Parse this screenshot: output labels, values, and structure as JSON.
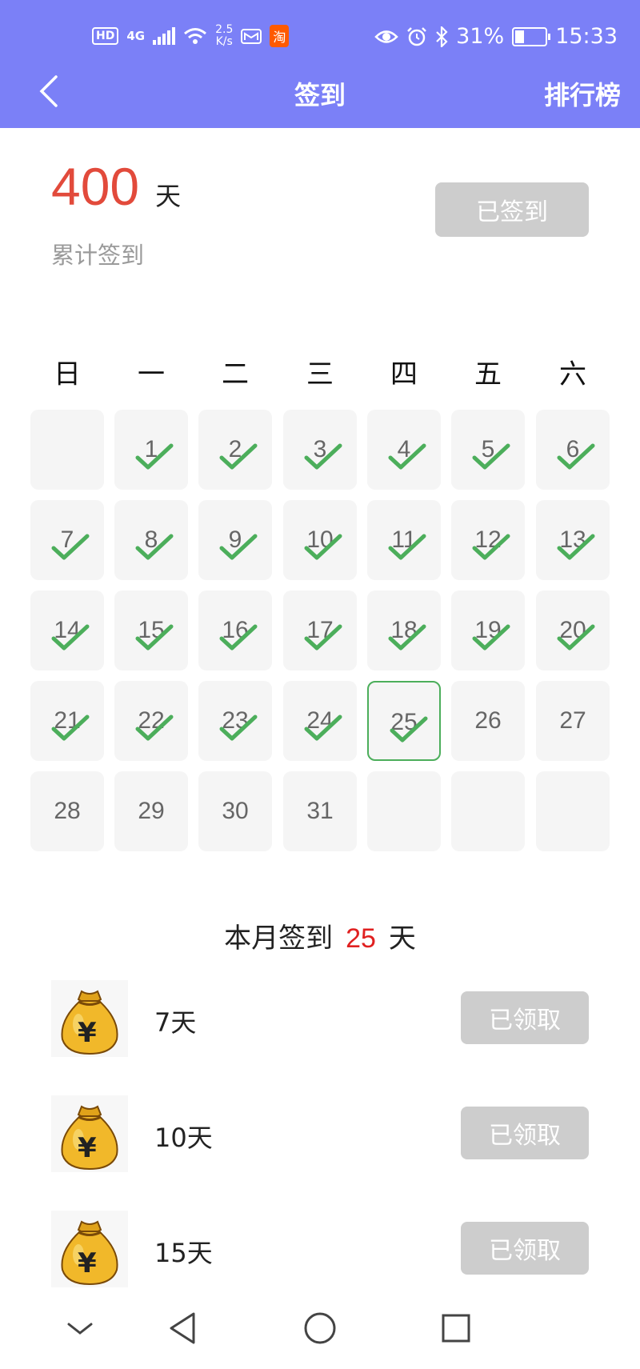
{
  "status_bar": {
    "hd": "HD",
    "network": "4G",
    "speed_value": "2.5",
    "speed_unit": "K/s",
    "taobao": "淘",
    "battery": "31%",
    "battery_level": 0.31,
    "time": "15:33"
  },
  "header": {
    "title": "签到",
    "right_action": "排行榜",
    "background_color": "#7b80f7"
  },
  "summary": {
    "total_days": "400",
    "unit": "天",
    "label": "累计签到",
    "signed_button": "已签到"
  },
  "calendar": {
    "weekdays": [
      "日",
      "一",
      "二",
      "三",
      "四",
      "五",
      "六"
    ],
    "days": [
      {
        "num": "",
        "checked": false,
        "today": false
      },
      {
        "num": "1",
        "checked": true,
        "today": false
      },
      {
        "num": "2",
        "checked": true,
        "today": false
      },
      {
        "num": "3",
        "checked": true,
        "today": false
      },
      {
        "num": "4",
        "checked": true,
        "today": false
      },
      {
        "num": "5",
        "checked": true,
        "today": false
      },
      {
        "num": "6",
        "checked": true,
        "today": false
      },
      {
        "num": "7",
        "checked": true,
        "today": false
      },
      {
        "num": "8",
        "checked": true,
        "today": false
      },
      {
        "num": "9",
        "checked": true,
        "today": false
      },
      {
        "num": "10",
        "checked": true,
        "today": false
      },
      {
        "num": "11",
        "checked": true,
        "today": false
      },
      {
        "num": "12",
        "checked": true,
        "today": false
      },
      {
        "num": "13",
        "checked": true,
        "today": false
      },
      {
        "num": "14",
        "checked": true,
        "today": false
      },
      {
        "num": "15",
        "checked": true,
        "today": false
      },
      {
        "num": "16",
        "checked": true,
        "today": false
      },
      {
        "num": "17",
        "checked": true,
        "today": false
      },
      {
        "num": "18",
        "checked": true,
        "today": false
      },
      {
        "num": "19",
        "checked": true,
        "today": false
      },
      {
        "num": "20",
        "checked": true,
        "today": false
      },
      {
        "num": "21",
        "checked": true,
        "today": false
      },
      {
        "num": "22",
        "checked": true,
        "today": false
      },
      {
        "num": "23",
        "checked": true,
        "today": false
      },
      {
        "num": "24",
        "checked": true,
        "today": false
      },
      {
        "num": "25",
        "checked": true,
        "today": true
      },
      {
        "num": "26",
        "checked": false,
        "today": false
      },
      {
        "num": "27",
        "checked": false,
        "today": false
      },
      {
        "num": "28",
        "checked": false,
        "today": false
      },
      {
        "num": "29",
        "checked": false,
        "today": false
      },
      {
        "num": "30",
        "checked": false,
        "today": false
      },
      {
        "num": "31",
        "checked": false,
        "today": false
      },
      {
        "num": "",
        "checked": false,
        "today": false
      },
      {
        "num": "",
        "checked": false,
        "today": false
      },
      {
        "num": "",
        "checked": false,
        "today": false
      }
    ],
    "check_color": "#4cae5b"
  },
  "month_summary": {
    "prefix": "本月签到",
    "count": "25",
    "suffix": "天"
  },
  "rewards": [
    {
      "label": "7天",
      "button": "已领取",
      "icon": "money-bag-icon"
    },
    {
      "label": "10天",
      "button": "已领取",
      "icon": "money-bag-icon"
    },
    {
      "label": "15天",
      "button": "已领取",
      "icon": "money-bag-icon"
    }
  ],
  "bag_symbol": "¥"
}
